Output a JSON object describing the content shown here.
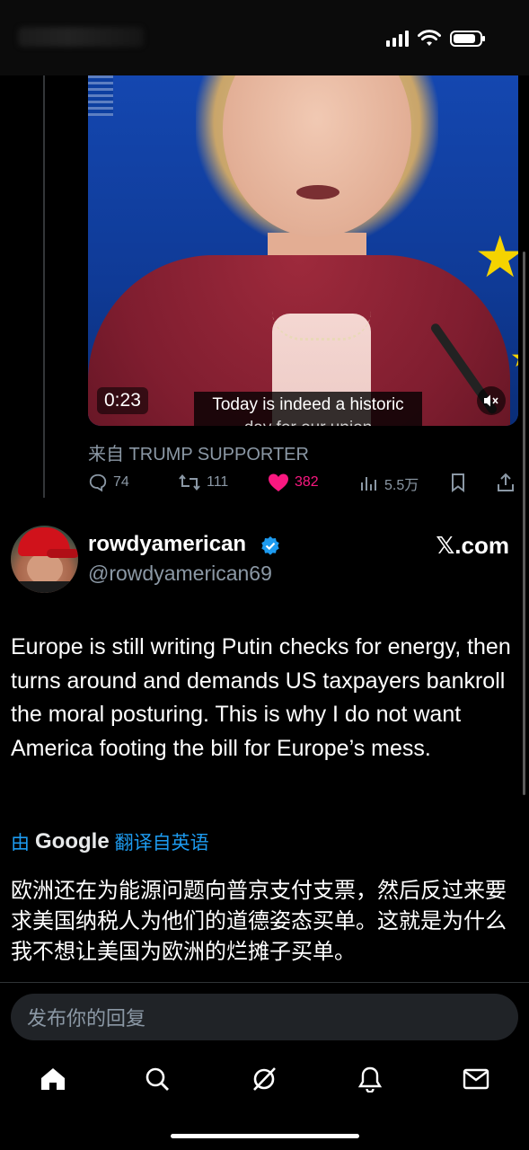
{
  "status_bar": {
    "signal_icon": "cellular-signal-icon",
    "wifi_icon": "wifi-icon",
    "battery_icon": "battery-icon"
  },
  "video": {
    "timestamp": "0:23",
    "caption_line1": "Today is indeed a historic",
    "caption_line2": "day for our union",
    "mute_icon": "speaker-muted-icon"
  },
  "quoted_source": "来自 TRUMP SUPPORTER",
  "actions": {
    "reply_count": "74",
    "retweet_count": "111",
    "like_count": "382",
    "view_count": "5.5万",
    "like_color": "#f91880"
  },
  "tweet": {
    "display_name": "rowdyamerican",
    "handle": "@rowdyamerican69",
    "site_badge": "𝕏.com",
    "text": "Europe is still writing Putin checks for energy, then turns around and demands US taxpayers bankroll the moral posturing. This is why I do not want America footing the bill for Europe’s mess.",
    "translate_prefix": "由",
    "translate_brand": "Google",
    "translate_suffix": "翻译自英语",
    "translated_text": "欧洲还在为能源问题向普京支付支票，然后反过来要求美国纳税人为他们的道德姿态买单。这就是为什么我不想让美国为欧洲的烂摊子买单。"
  },
  "reply": {
    "placeholder": "发布你的回复"
  },
  "nav": [
    "home-icon",
    "search-icon",
    "grok-icon",
    "notifications-icon",
    "messages-icon"
  ],
  "colors": {
    "accent": "#1d9bf0",
    "verified": "#1d9bf0"
  }
}
